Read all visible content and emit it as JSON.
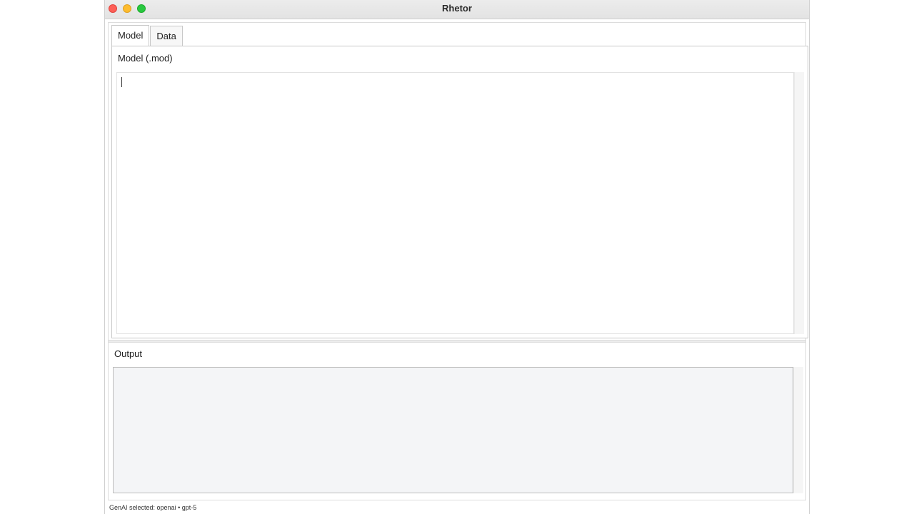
{
  "window": {
    "title": "Rhetor"
  },
  "tabs": [
    {
      "label": "Model",
      "active": true
    },
    {
      "label": "Data",
      "active": false
    }
  ],
  "model_panel": {
    "label": "Model (.mod)",
    "editor_value": ""
  },
  "output_panel": {
    "label": "Output",
    "value": ""
  },
  "statusbar": {
    "text": "GenAI selected: openai • gpt-5"
  },
  "colors": {
    "close": "#fe5f57",
    "minimize": "#febc2e",
    "maximize": "#28c840",
    "output_background": "#f4f5f7"
  }
}
